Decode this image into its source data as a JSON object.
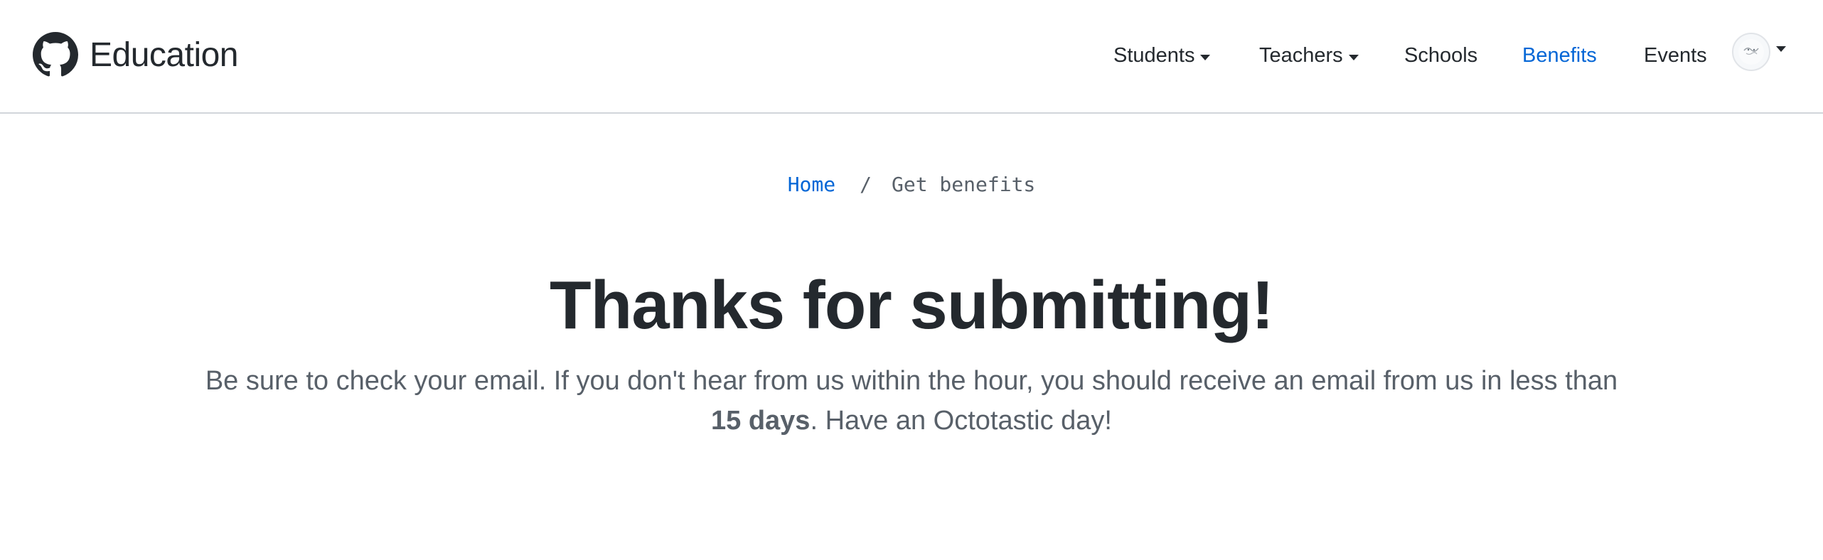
{
  "brand": {
    "logo_icon": "github-octocat-icon",
    "name": "Education"
  },
  "nav": {
    "items": [
      {
        "label": "Students",
        "dropdown": true
      },
      {
        "label": "Teachers",
        "dropdown": true
      },
      {
        "label": "Schools",
        "dropdown": false
      },
      {
        "label": "Benefits",
        "dropdown": false,
        "active": true
      },
      {
        "label": "Events",
        "dropdown": false
      }
    ],
    "avatar_icon": "user-avatar",
    "active_color": "#0366d6"
  },
  "breadcrumb": {
    "home": "Home",
    "separator": "/",
    "current": "Get benefits"
  },
  "main": {
    "title": "Thanks for submitting!",
    "lead_before": "Be sure to check your email. If you don't hear from us within the hour, you should receive an email from us in less than ",
    "lead_bold": "15 days",
    "lead_after": ". Have an Octotastic day!"
  }
}
